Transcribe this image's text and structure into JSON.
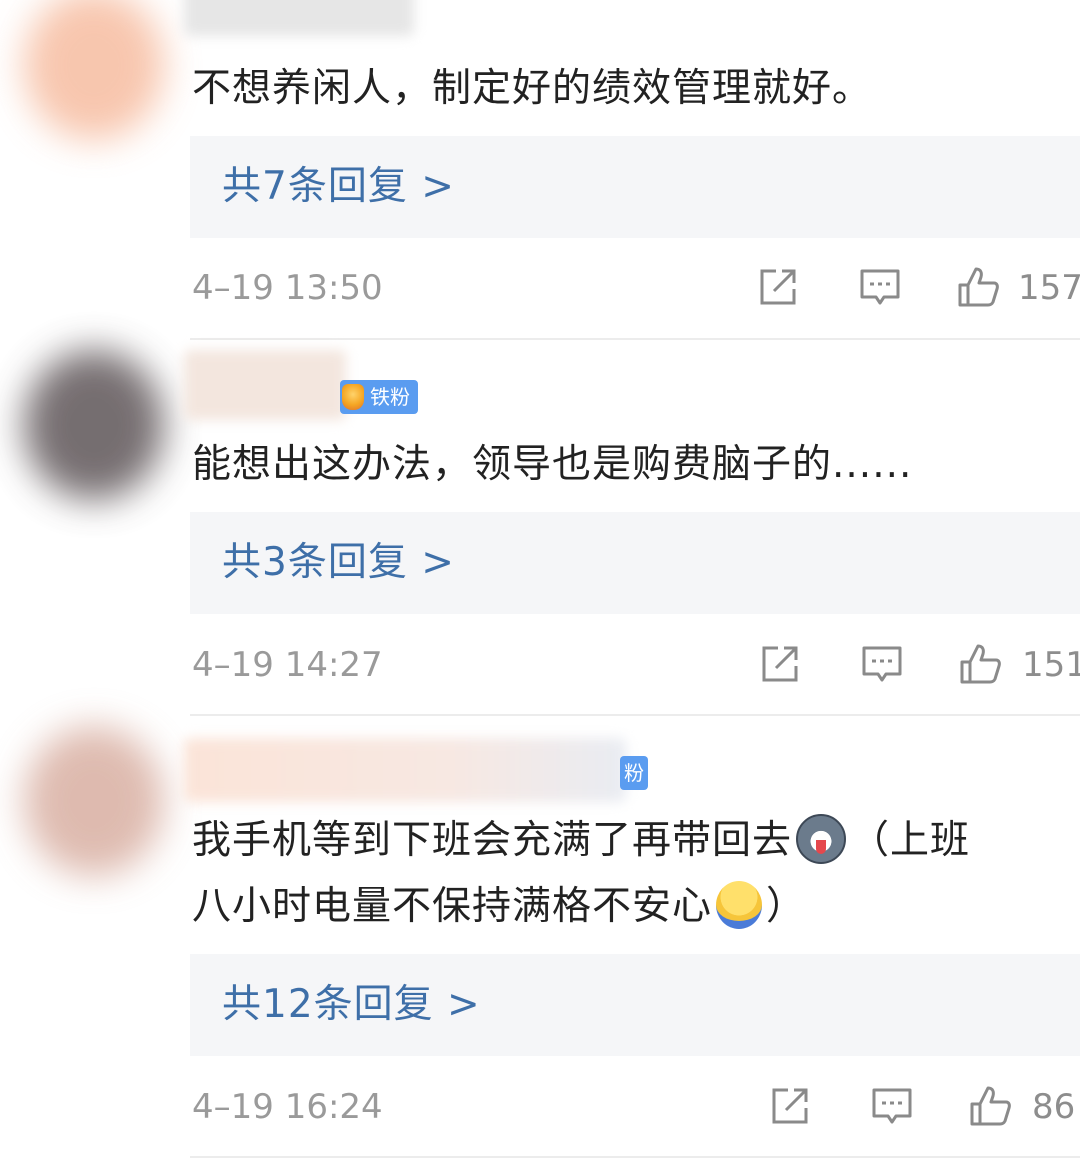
{
  "comments": [
    {
      "text": "不想养闲人，制定好的绩效管理就好。",
      "replies": "共7条回复 >",
      "time": "4–19 13:50",
      "likes": "157",
      "badge": "",
      "avatar_color": "#f6c3a6"
    },
    {
      "text": "能想出这办法，领导也是购费脑子的......",
      "replies": "共3条回复 >",
      "time": "4–19 14:27",
      "likes": "151",
      "badge": "铁粉",
      "avatar_color": "#6e6468"
    },
    {
      "text_line1": "我手机等到下班会充满了再带回去",
      "text_line1_after": "（上班",
      "text_line2": "八小时电量不保持满格不安心",
      "text_line2_after": "）",
      "replies": "共12条回复 >",
      "time": "4–19 16:24",
      "likes": "86",
      "badge": "粉",
      "avatar_color": "#d8b3a8",
      "emojis": [
        "husky-face-emoji",
        "worried-face-emoji"
      ]
    }
  ],
  "colors": {
    "link": "#3e6fa8",
    "badge": "#5a9cf0",
    "meta": "#9a9a9a",
    "reply_bg": "#f5f6f8"
  },
  "icons": [
    "share-icon",
    "comment-icon",
    "thumbs-up-icon"
  ]
}
